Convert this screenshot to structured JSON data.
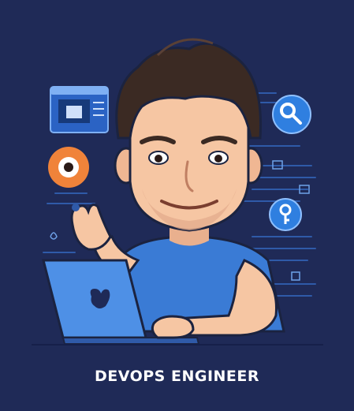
{
  "caption": "DEVOPS ENGINEER",
  "colors": {
    "background": "#1f2a57",
    "shirt": "#3a7bd5",
    "skin": "#f6c6a3",
    "hair": "#3b2a23",
    "laptop": "#4e90e6",
    "accent_orange": "#f0833a"
  },
  "icons": [
    "browser-window-icon",
    "orange-eye-icon",
    "magnifier-icon",
    "key-icon",
    "apple-logo-icon"
  ]
}
